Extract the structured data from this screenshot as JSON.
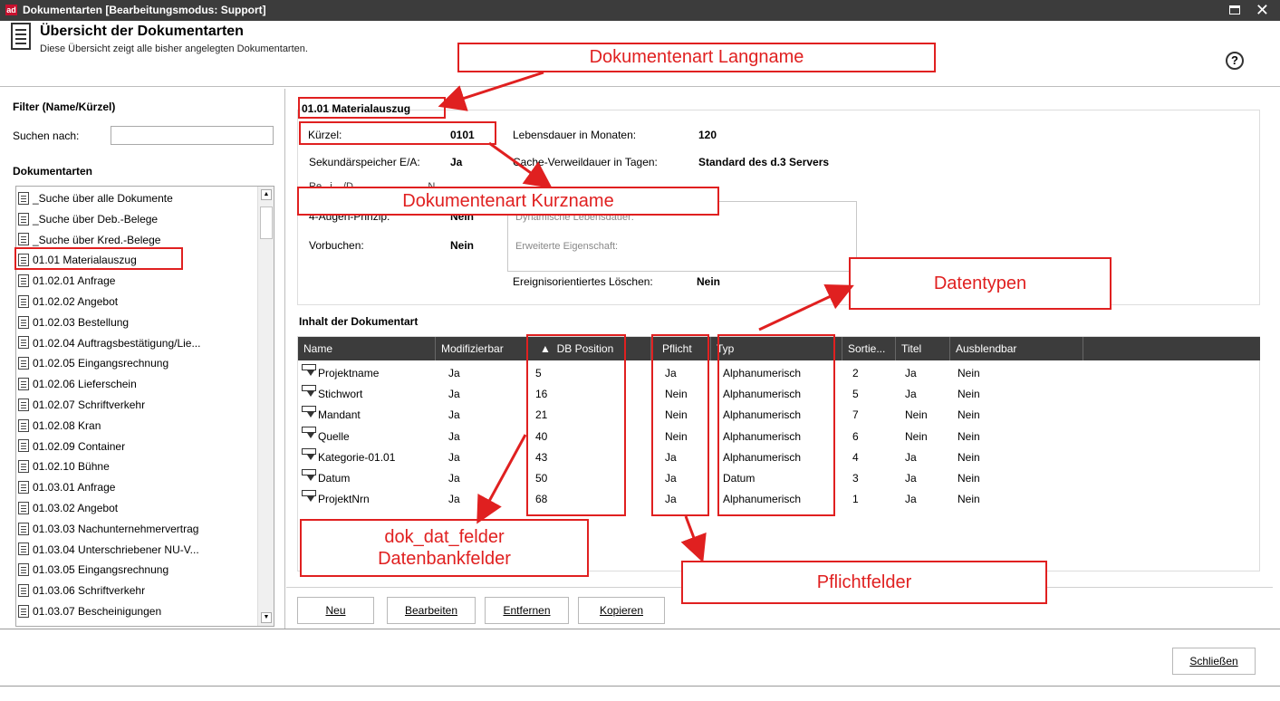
{
  "window": {
    "app_badge": "ad",
    "title": "Dokumentarten  [Bearbeitungsmodus: Support]",
    "close_glyph": "✕"
  },
  "header": {
    "title": "Übersicht der Dokumentarten",
    "subtitle": "Diese Übersicht zeigt alle bisher angelegten Dokumentarten.",
    "help_glyph": "?"
  },
  "filter": {
    "heading": "Filter (Name/Kürzel)",
    "search_label": "Suchen nach:",
    "search_value": ""
  },
  "doclist": {
    "heading": "Dokumentarten",
    "items": [
      "_Suche über alle Dokumente",
      "_Suche über Deb.-Belege",
      "_Suche über Kred.-Belege",
      "01.01 Materialauszug",
      "01.02.01 Anfrage",
      "01.02.02 Angebot",
      "01.02.03 Bestellung",
      "01.02.04 Auftragsbestätigung/Lie...",
      "01.02.05 Eingangsrechnung",
      "01.02.06 Lieferschein",
      "01.02.07 Schriftverkehr",
      "01.02.08 Kran",
      "01.02.09 Container",
      "01.02.10 Bühne",
      "01.03.01 Anfrage",
      "01.03.02 Angebot",
      "01.03.03 Nachunternehmervertrag",
      "01.03.04 Unterschriebener NU-V...",
      "01.03.05 Eingangsrechnung",
      "01.03.06 Schriftverkehr",
      "01.03.07 Bescheinigungen"
    ],
    "selected_index": 3
  },
  "detail": {
    "title": "01.01 Materialauszug",
    "kuerzel_label": "Kürzel:",
    "kuerzel_value": "0101",
    "lebensdauer_label": "Lebensdauer in Monaten:",
    "lebensdauer_value": "120",
    "sek_label": "Sekundärspeicher E/A:",
    "sek_value": "Ja",
    "cache_label": "Cache-Verweildauer in Tagen:",
    "cache_value": "Standard des d.3 Servers",
    "partial_row": "Re...i...  /D...  ...  ...  ...  ...  ...  ...N...",
    "vieraugen_label": "4-Augen-Prinzip:",
    "vieraugen_value": "Nein",
    "dyn_placeholder": "Dynamische Lebensdauer:",
    "vorbuchen_label": "Vorbuchen:",
    "vorbuchen_value": "Nein",
    "erw_placeholder": "Erweiterte Eigenschaft:",
    "ereignis_label": "Ereignisorientiertes Löschen:",
    "ereignis_value": "Nein"
  },
  "content": {
    "heading": "Inhalt der Dokumentart",
    "columns": [
      "Name",
      "Modifizierbar",
      "DB Position",
      "Pflicht",
      "Typ",
      "Sortie...",
      "Titel",
      "Ausblendbar"
    ],
    "sort_glyph": "▲",
    "rows": [
      {
        "name": "Projektname",
        "mod": "Ja",
        "db": "5",
        "pflicht": "Ja",
        "typ": "Alphanumerisch",
        "sort": "2",
        "titel": "Ja",
        "ausb": "Nein"
      },
      {
        "name": "Stichwort",
        "mod": "Ja",
        "db": "16",
        "pflicht": "Nein",
        "typ": "Alphanumerisch",
        "sort": "5",
        "titel": "Ja",
        "ausb": "Nein"
      },
      {
        "name": "Mandant",
        "mod": "Ja",
        "db": "21",
        "pflicht": "Nein",
        "typ": "Alphanumerisch",
        "sort": "7",
        "titel": "Nein",
        "ausb": "Nein"
      },
      {
        "name": "Quelle",
        "mod": "Ja",
        "db": "40",
        "pflicht": "Nein",
        "typ": "Alphanumerisch",
        "sort": "6",
        "titel": "Nein",
        "ausb": "Nein"
      },
      {
        "name": "Kategorie-01.01",
        "mod": "Ja",
        "db": "43",
        "pflicht": "Ja",
        "typ": "Alphanumerisch",
        "sort": "4",
        "titel": "Ja",
        "ausb": "Nein"
      },
      {
        "name": "Datum",
        "mod": "Ja",
        "db": "50",
        "pflicht": "Ja",
        "typ": "Datum",
        "sort": "3",
        "titel": "Ja",
        "ausb": "Nein"
      },
      {
        "name": "ProjektNrn",
        "mod": "Ja",
        "db": "68",
        "pflicht": "Ja",
        "typ": "Alphanumerisch",
        "sort": "1",
        "titel": "Ja",
        "ausb": "Nein"
      }
    ]
  },
  "buttons": {
    "neu": "Neu",
    "bearbeiten": "Bearbeiten",
    "entfernen": "Entfernen",
    "kopieren": "Kopieren",
    "schliessen": "Schließen"
  },
  "annotations": {
    "color": "#e02020",
    "langname": "Dokumentenart Langname",
    "kurzname": "Dokumentenart Kurzname",
    "datentypen": "Datentypen",
    "dbfelder_line1": "dok_dat_felder",
    "dbfelder_line2": "Datenbankfelder",
    "pflichtfelder": "Pflichtfelder"
  }
}
